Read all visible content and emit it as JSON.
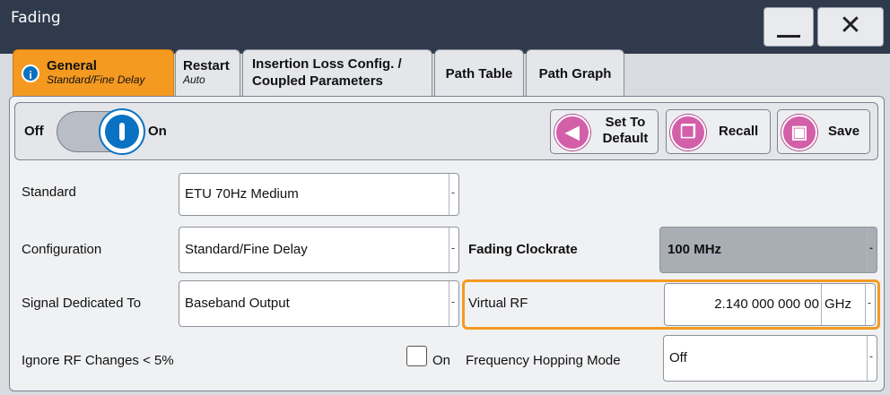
{
  "window": {
    "title": "Fading",
    "minimize_icon": "minimize-icon",
    "close_glyph": "✕"
  },
  "tabs": [
    {
      "label": "General",
      "sub": "Standard/Fine Delay",
      "active": true
    },
    {
      "label": "Restart",
      "sub": "Auto"
    },
    {
      "label_line1": "Insertion Loss Config. /",
      "label_line2": "Coupled Parameters"
    },
    {
      "label": "Path Table"
    },
    {
      "label": "Path Graph"
    }
  ],
  "toolbar": {
    "off_label": "Off",
    "on_label": "On",
    "state": "on",
    "default_label_1": "Set To",
    "default_label_2": "Default",
    "recall_label": "Recall",
    "save_label": "Save"
  },
  "form": {
    "standard_label": "Standard",
    "standard_value": "ETU  70Hz Medium",
    "configuration_label": "Configuration",
    "configuration_value": "Standard/Fine Delay",
    "clockrate_label": "Fading Clockrate",
    "clockrate_value": "100 MHz",
    "signal_label": "Signal Dedicated To",
    "signal_value": "Baseband Output",
    "virtual_rf_label": "Virtual RF",
    "virtual_rf_value": "2.140 000 000 00",
    "virtual_rf_unit": "GHz",
    "ignore_rf_label": "Ignore RF Changes < 5%",
    "ignore_rf_on_label": "On",
    "ignore_rf_checked": false,
    "hopping_label": "Frequency Hopping Mode",
    "hopping_value": "Off"
  },
  "colors": {
    "accent": "#f59a21",
    "title_bar": "#2f3a4d",
    "toggle_blue": "#0a72c2",
    "button_icon": "#d35fa9"
  }
}
